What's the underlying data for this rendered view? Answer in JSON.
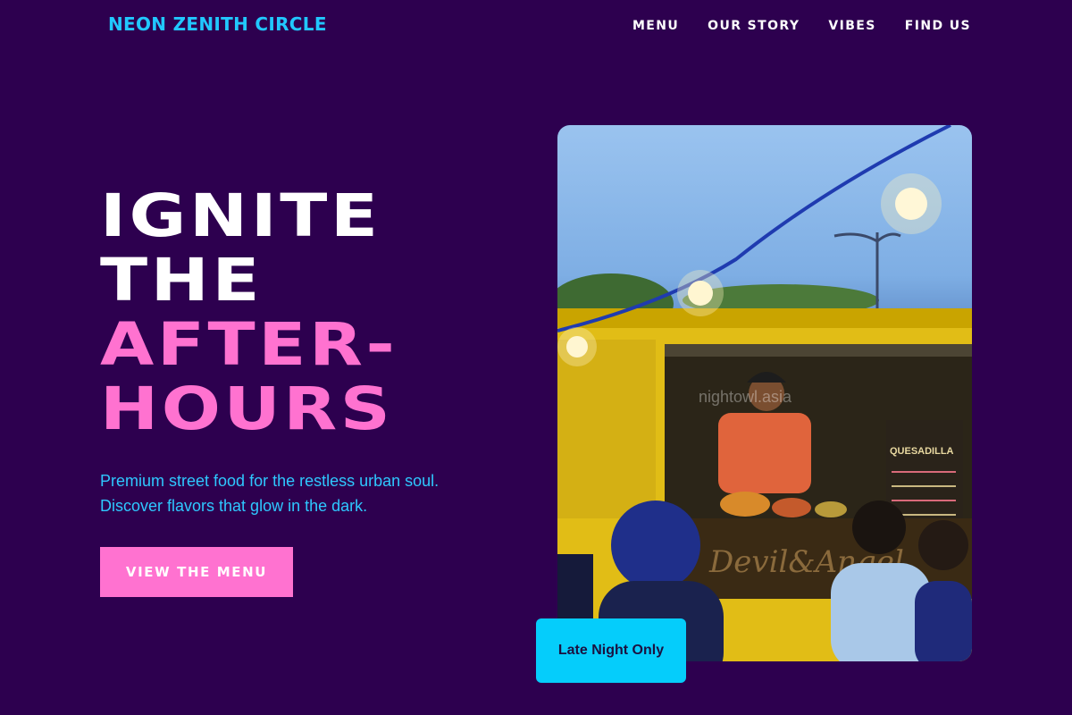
{
  "nav": {
    "brand": "NEON ZENITH CIRCLE",
    "links": [
      "MENU",
      "OUR STORY",
      "VIBES",
      "FIND US"
    ]
  },
  "hero": {
    "title_lines": [
      {
        "text": "IGNITE",
        "color": "#ffffff"
      },
      {
        "text": "THE",
        "color": "#ffffff"
      },
      {
        "text": "AFTER-",
        "color": "#ff72d0"
      },
      {
        "text": "HOURS",
        "color": "#ff72d0"
      }
    ],
    "subtitle_lines": [
      "Premium street food for the restless urban soul.",
      "Discover flavors that glow in the dark."
    ],
    "cta_label": "VIEW THE MENU"
  },
  "photo": {
    "watermark": "nightowl.asia",
    "menu_board_text": "QUESADILLA",
    "truck_sign": "Devil&Angel"
  },
  "badge": {
    "label": "Late Night Only"
  },
  "colors": {
    "background": "#2d004f",
    "accent_cyan": "#21c8ff",
    "accent_pink": "#ff72d0",
    "badge_bg": "#05cdfb"
  }
}
